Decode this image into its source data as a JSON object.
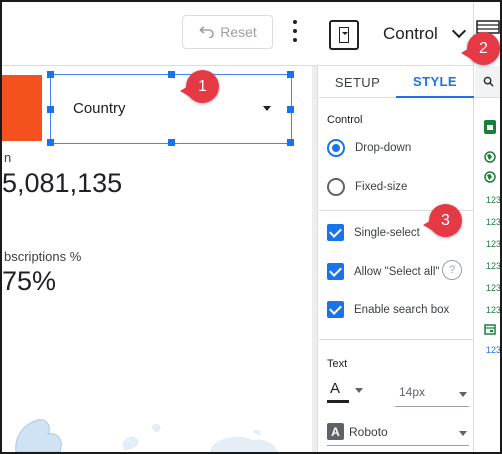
{
  "toolbar": {
    "reset_label": "Reset"
  },
  "canvas": {
    "control_label": "Country",
    "metric1": {
      "label": "n",
      "value": "5,081,135"
    },
    "metric2": {
      "label": "bscriptions %",
      "value": "75%"
    }
  },
  "badges": [
    "1",
    "2",
    "3"
  ],
  "panel": {
    "title": "Control",
    "tabs": {
      "setup": "SETUP",
      "style": "STYLE"
    },
    "control_section": "Control",
    "options": {
      "dropdown": "Drop-down",
      "fixed_size": "Fixed-size",
      "single_select": "Single-select",
      "allow_select_all": "Allow \"Select all\"",
      "enable_search": "Enable search box"
    },
    "help_glyph": "?",
    "text_section": "Text",
    "font_color_letter": "A",
    "font_size": "14px",
    "font_family_icon": "A",
    "font_family": "Roboto"
  },
  "strip": {
    "field_types": [
      "123",
      "123",
      "123",
      "123",
      "123",
      "123",
      "123"
    ]
  },
  "colors": {
    "accent": "#1a73e8",
    "badge": "#e53946",
    "orange_tile": "#f4511e"
  }
}
